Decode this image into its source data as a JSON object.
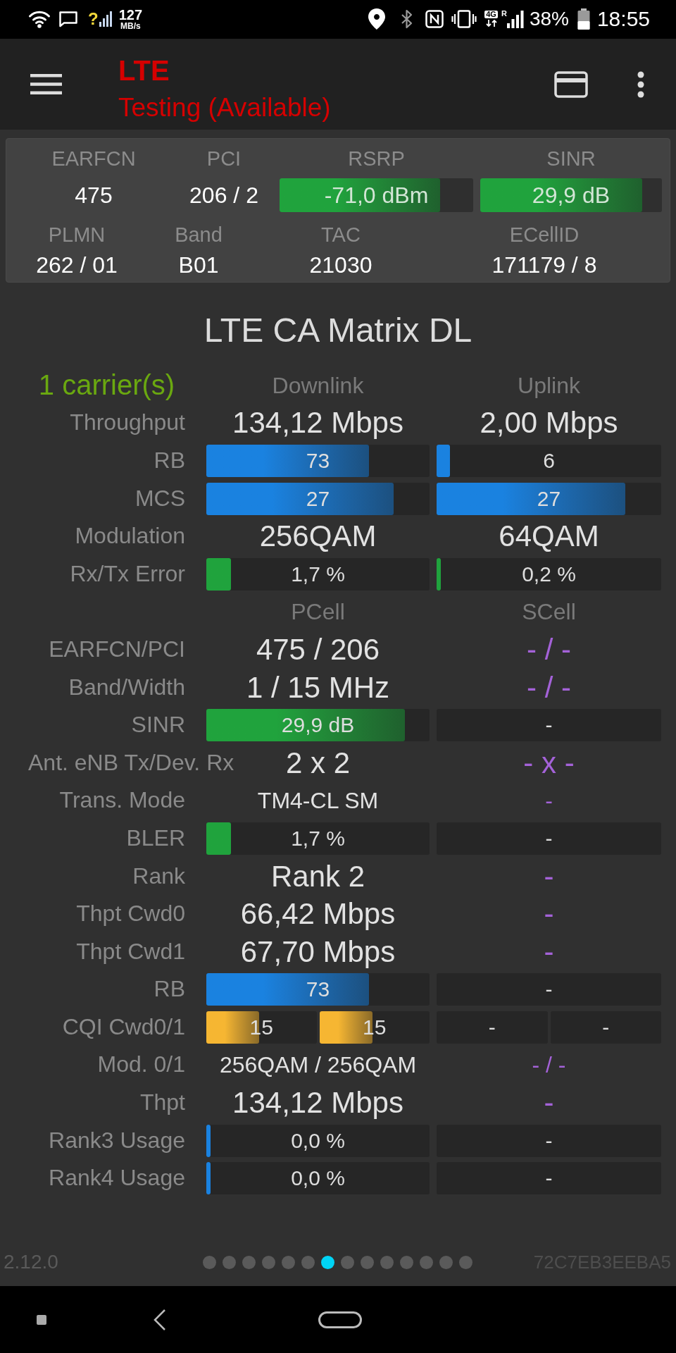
{
  "status_bar": {
    "signal_status": "?",
    "data_rate": "127",
    "data_rate_unit": "MB/s",
    "network_type": "4G",
    "roaming": "R",
    "battery": "38%",
    "time": "18:55"
  },
  "app_bar": {
    "title": "LTE",
    "subtitle": "Testing (Available)"
  },
  "cell_info": {
    "rows": [
      {
        "cells": [
          {
            "kind": "text",
            "label": "EARFCN",
            "value": "475"
          },
          {
            "kind": "text",
            "label": "PCI",
            "value": "206 / 2"
          },
          {
            "kind": "bar",
            "label": "RSRP",
            "value": "-71,0 dBm",
            "level": 0.83,
            "color": "#20a33d"
          },
          {
            "kind": "bar",
            "label": "SINR",
            "value": "29,9 dB",
            "level": 0.89,
            "color": "#20a33d"
          }
        ]
      },
      {
        "cells": [
          {
            "kind": "text",
            "label": "PLMN",
            "value": "262 / 01"
          },
          {
            "kind": "text",
            "label": "Band",
            "value": "B01"
          },
          {
            "kind": "text",
            "label": "TAC",
            "value": "21030"
          },
          {
            "kind": "text",
            "label": "ECellID",
            "value": "171179 / 8"
          }
        ]
      }
    ]
  },
  "matrix": {
    "title": "LTE CA Matrix DL",
    "rows": [
      {
        "kind": "section",
        "label": "1 carrier(s)",
        "cells": [
          {
            "kind": "heading",
            "text": "Downlink"
          },
          {
            "kind": "heading",
            "text": "Uplink"
          }
        ]
      },
      {
        "kind": "metric",
        "label": "Throughput",
        "cells": [
          {
            "kind": "text",
            "text": "134,12 Mbps"
          },
          {
            "kind": "text",
            "text": "2,00 Mbps"
          }
        ]
      },
      {
        "kind": "metric",
        "label": "RB",
        "cells": [
          {
            "kind": "bar",
            "text": "73",
            "level": 0.73,
            "color": "#1a82e0"
          },
          {
            "kind": "bar",
            "text": "6",
            "level": 0.06,
            "color": "#1a82e0"
          }
        ]
      },
      {
        "kind": "metric",
        "label": "MCS",
        "cells": [
          {
            "kind": "bar",
            "text": "27",
            "level": 0.84,
            "color": "#1a82e0"
          },
          {
            "kind": "bar",
            "text": "27",
            "level": 0.84,
            "color": "#1a82e0"
          }
        ]
      },
      {
        "kind": "metric",
        "label": "Modulation",
        "cells": [
          {
            "kind": "text",
            "text": "256QAM"
          },
          {
            "kind": "text",
            "text": "64QAM"
          }
        ]
      },
      {
        "kind": "metric",
        "label": "Rx/Tx Error",
        "cells": [
          {
            "kind": "bar",
            "text": "1,7 %",
            "level": 0.11,
            "color": "#20a33d"
          },
          {
            "kind": "bar",
            "text": "0,2 %",
            "level": 0.02,
            "color": "#20a33d"
          }
        ]
      },
      {
        "kind": "section",
        "cells": [
          {
            "kind": "heading",
            "text": "PCell"
          },
          {
            "kind": "heading",
            "text": "SCell"
          }
        ]
      },
      {
        "kind": "metric",
        "label": "EARFCN/PCI",
        "cells": [
          {
            "kind": "text",
            "text": "475 / 206"
          },
          {
            "kind": "text",
            "text": "- / -",
            "color": "#a462d8"
          }
        ]
      },
      {
        "kind": "metric",
        "label": "Band/Width",
        "cells": [
          {
            "kind": "text",
            "text": "1 / 15 MHz"
          },
          {
            "kind": "text",
            "text": "- / -",
            "color": "#a462d8"
          }
        ]
      },
      {
        "kind": "metric",
        "label": "SINR",
        "cells": [
          {
            "kind": "bar",
            "text": "29,9 dB",
            "level": 0.89,
            "color": "#20a33d"
          },
          {
            "kind": "bar",
            "text": "-"
          }
        ]
      },
      {
        "kind": "metric",
        "label": "Ant. eNB Tx/Dev. Rx",
        "cells": [
          {
            "kind": "text",
            "text": "2 x 2"
          },
          {
            "kind": "text",
            "text": "- x -",
            "color": "#a462d8"
          }
        ]
      },
      {
        "kind": "metric",
        "label": "Trans. Mode",
        "cells": [
          {
            "kind": "small_text",
            "text": "TM4-CL SM"
          },
          {
            "kind": "small_text",
            "text": "-",
            "color": "#a462d8"
          }
        ]
      },
      {
        "kind": "metric",
        "label": "BLER",
        "cells": [
          {
            "kind": "bar",
            "text": "1,7 %",
            "level": 0.11,
            "color": "#20a33d"
          },
          {
            "kind": "bar",
            "text": "-"
          }
        ]
      },
      {
        "kind": "metric",
        "label": "Rank",
        "cells": [
          {
            "kind": "text",
            "text": "Rank 2"
          },
          {
            "kind": "text",
            "text": "-",
            "color": "#a462d8"
          }
        ]
      },
      {
        "kind": "metric",
        "label": "Thpt Cwd0",
        "cells": [
          {
            "kind": "text",
            "text": "66,42 Mbps"
          },
          {
            "kind": "text",
            "text": "-",
            "color": "#a462d8"
          }
        ]
      },
      {
        "kind": "metric",
        "label": "Thpt Cwd1",
        "cells": [
          {
            "kind": "text",
            "text": "67,70 Mbps"
          },
          {
            "kind": "text",
            "text": "-",
            "color": "#a462d8"
          }
        ]
      },
      {
        "kind": "metric",
        "label": "RB",
        "cells": [
          {
            "kind": "bar",
            "text": "73",
            "level": 0.73,
            "color": "#1a82e0"
          },
          {
            "kind": "bar",
            "text": "-"
          }
        ]
      },
      {
        "kind": "metric",
        "label": "CQI Cwd0/1",
        "cells": [
          {
            "kind": "split",
            "bars": [
              {
                "text": "15",
                "level": 0.48,
                "color": "#f6b632"
              },
              {
                "text": "15",
                "level": 0.48,
                "color": "#f6b632"
              }
            ]
          },
          {
            "kind": "split",
            "bars": [
              {
                "text": "-"
              },
              {
                "text": "-"
              }
            ]
          }
        ]
      },
      {
        "kind": "metric",
        "label": "Mod. 0/1",
        "cells": [
          {
            "kind": "small_text",
            "text": "256QAM / 256QAM"
          },
          {
            "kind": "small_text",
            "text": "- / -",
            "color": "#a462d8"
          }
        ]
      },
      {
        "kind": "metric",
        "label": "Thpt",
        "cells": [
          {
            "kind": "text",
            "text": "134,12 Mbps"
          },
          {
            "kind": "text",
            "text": "-",
            "color": "#a462d8"
          }
        ]
      },
      {
        "kind": "metric",
        "label": "Rank3 Usage",
        "cells": [
          {
            "kind": "bar",
            "text": "0,0 %",
            "level": 0.02,
            "color": "#1a82e0"
          },
          {
            "kind": "bar",
            "text": "-"
          }
        ]
      },
      {
        "kind": "metric",
        "label": "Rank4 Usage",
        "cells": [
          {
            "kind": "bar",
            "text": "0,0 %",
            "level": 0.02,
            "color": "#1a82e0"
          },
          {
            "kind": "bar",
            "text": "-"
          }
        ]
      }
    ]
  },
  "footer": {
    "version": "2.12.0",
    "pages": [
      {
        "selected": false
      },
      {
        "selected": false
      },
      {
        "selected": false
      },
      {
        "selected": false
      },
      {
        "selected": false
      },
      {
        "selected": false
      },
      {
        "selected": true
      },
      {
        "selected": false
      },
      {
        "selected": false
      },
      {
        "selected": false
      },
      {
        "selected": false
      },
      {
        "selected": false
      },
      {
        "selected": false
      },
      {
        "selected": false
      }
    ],
    "device_id": "72C7EB3EEBA5"
  }
}
